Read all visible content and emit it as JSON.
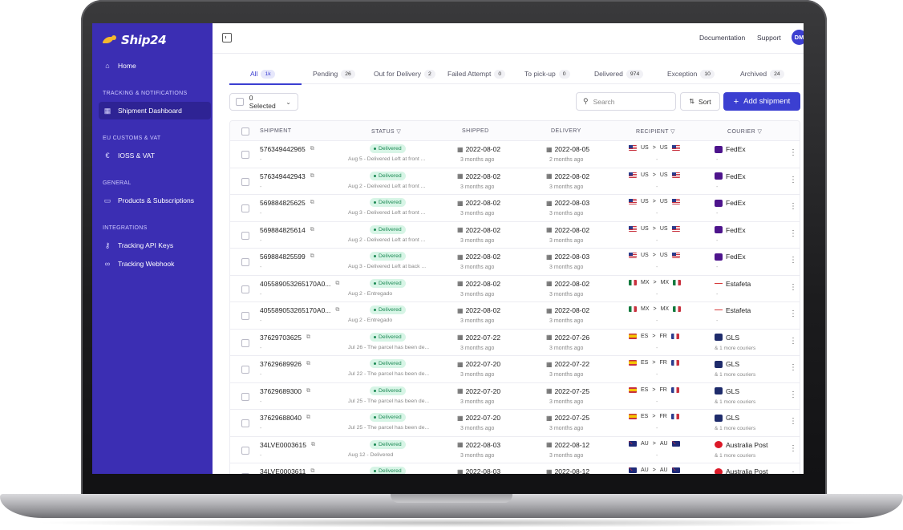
{
  "app": {
    "brand": "Ship24"
  },
  "sidebar": {
    "home": "Home",
    "sections": [
      {
        "title": "TRACKING & NOTIFICATIONS",
        "items": [
          "Shipment Dashboard"
        ]
      },
      {
        "title": "EU CUSTOMS & VAT",
        "items": [
          "IOSS & VAT"
        ]
      },
      {
        "title": "GENERAL",
        "items": [
          "Products & Subscriptions"
        ]
      },
      {
        "title": "INTEGRATIONS",
        "items": [
          "Tracking API Keys",
          "Tracking Webhook"
        ]
      }
    ]
  },
  "topbar": {
    "documentation": "Documentation",
    "support": "Support",
    "avatar": "DM"
  },
  "tabs": [
    {
      "label": "All",
      "count": "1k"
    },
    {
      "label": "Pending",
      "count": "26"
    },
    {
      "label": "Out for Delivery",
      "count": "2"
    },
    {
      "label": "Failed Attempt",
      "count": "0"
    },
    {
      "label": "To pick-up",
      "count": "0"
    },
    {
      "label": "Delivered",
      "count": "974"
    },
    {
      "label": "Exception",
      "count": "10"
    },
    {
      "label": "Archived",
      "count": "24"
    }
  ],
  "toolbar": {
    "selected": "0 Selected",
    "search_placeholder": "Search",
    "sort": "Sort",
    "add": "Add shipment"
  },
  "table": {
    "headers": [
      "SHIPMENT",
      "STATUS",
      "SHIPPED",
      "DELIVERY",
      "RECIPIENT",
      "COURIER"
    ],
    "rows": [
      {
        "id": "576349442965",
        "status": "Delivered",
        "note": "Aug 5 - Delivered Left at front ...",
        "shipped": "2022-08-02",
        "shipped_ago": "3 months ago",
        "delivery": "2022-08-05",
        "delivery_ago": "2 months ago",
        "from": "US",
        "to": "US",
        "from_flag": "us",
        "to_flag": "us",
        "courier": "FedEx",
        "courier_logo": "fedex",
        "more": ""
      },
      {
        "id": "576349442943",
        "status": "Delivered",
        "note": "Aug 2 - Delivered Left at front ...",
        "shipped": "2022-08-02",
        "shipped_ago": "3 months ago",
        "delivery": "2022-08-02",
        "delivery_ago": "3 months ago",
        "from": "US",
        "to": "US",
        "from_flag": "us",
        "to_flag": "us",
        "courier": "FedEx",
        "courier_logo": "fedex",
        "more": ""
      },
      {
        "id": "569884825625",
        "status": "Delivered",
        "note": "Aug 3 - Delivered Left at front ...",
        "shipped": "2022-08-02",
        "shipped_ago": "3 months ago",
        "delivery": "2022-08-03",
        "delivery_ago": "3 months ago",
        "from": "US",
        "to": "US",
        "from_flag": "us",
        "to_flag": "us",
        "courier": "FedEx",
        "courier_logo": "fedex",
        "more": ""
      },
      {
        "id": "569884825614",
        "status": "Delivered",
        "note": "Aug 2 - Delivered Left at front ...",
        "shipped": "2022-08-02",
        "shipped_ago": "3 months ago",
        "delivery": "2022-08-02",
        "delivery_ago": "3 months ago",
        "from": "US",
        "to": "US",
        "from_flag": "us",
        "to_flag": "us",
        "courier": "FedEx",
        "courier_logo": "fedex",
        "more": ""
      },
      {
        "id": "569884825599",
        "status": "Delivered",
        "note": "Aug 3 - Delivered Left at back ...",
        "shipped": "2022-08-02",
        "shipped_ago": "3 months ago",
        "delivery": "2022-08-03",
        "delivery_ago": "3 months ago",
        "from": "US",
        "to": "US",
        "from_flag": "us",
        "to_flag": "us",
        "courier": "FedEx",
        "courier_logo": "fedex",
        "more": ""
      },
      {
        "id": "405589053265170A0...",
        "status": "Delivered",
        "note": "Aug 2 - Entregado",
        "shipped": "2022-08-02",
        "shipped_ago": "3 months ago",
        "delivery": "2022-08-02",
        "delivery_ago": "3 months ago",
        "from": "MX",
        "to": "MX",
        "from_flag": "mx",
        "to_flag": "mx",
        "courier": "Estafeta",
        "courier_logo": "estafeta",
        "more": ""
      },
      {
        "id": "405589053265170A0...",
        "status": "Delivered",
        "note": "Aug 2 - Entregado",
        "shipped": "2022-08-02",
        "shipped_ago": "3 months ago",
        "delivery": "2022-08-02",
        "delivery_ago": "3 months ago",
        "from": "MX",
        "to": "MX",
        "from_flag": "mx",
        "to_flag": "mx",
        "courier": "Estafeta",
        "courier_logo": "estafeta",
        "more": ""
      },
      {
        "id": "37629703625",
        "status": "Delivered",
        "note": "Jul 26 - The parcel has been de...",
        "shipped": "2022-07-22",
        "shipped_ago": "3 months ago",
        "delivery": "2022-07-26",
        "delivery_ago": "3 months ago",
        "from": "ES",
        "to": "FR",
        "from_flag": "es",
        "to_flag": "fr",
        "courier": "GLS",
        "courier_logo": "gls",
        "more": "& 1 more couriers"
      },
      {
        "id": "37629689926",
        "status": "Delivered",
        "note": "Jul 22 - The parcel has been de...",
        "shipped": "2022-07-20",
        "shipped_ago": "3 months ago",
        "delivery": "2022-07-22",
        "delivery_ago": "3 months ago",
        "from": "ES",
        "to": "FR",
        "from_flag": "es",
        "to_flag": "fr",
        "courier": "GLS",
        "courier_logo": "gls",
        "more": "& 1 more couriers"
      },
      {
        "id": "37629689300",
        "status": "Delivered",
        "note": "Jul 25 - The parcel has been de...",
        "shipped": "2022-07-20",
        "shipped_ago": "3 months ago",
        "delivery": "2022-07-25",
        "delivery_ago": "3 months ago",
        "from": "ES",
        "to": "FR",
        "from_flag": "es",
        "to_flag": "fr",
        "courier": "GLS",
        "courier_logo": "gls",
        "more": "& 1 more couriers"
      },
      {
        "id": "37629688040",
        "status": "Delivered",
        "note": "Jul 25 - The parcel has been de...",
        "shipped": "2022-07-20",
        "shipped_ago": "3 months ago",
        "delivery": "2022-07-25",
        "delivery_ago": "3 months ago",
        "from": "ES",
        "to": "FR",
        "from_flag": "es",
        "to_flag": "fr",
        "courier": "GLS",
        "courier_logo": "gls",
        "more": "& 1 more couriers"
      },
      {
        "id": "34LVE0003615",
        "status": "Delivered",
        "note": "Aug 12 - Delivered",
        "shipped": "2022-08-03",
        "shipped_ago": "3 months ago",
        "delivery": "2022-08-12",
        "delivery_ago": "3 months ago",
        "from": "AU",
        "to": "AU",
        "from_flag": "au",
        "to_flag": "au",
        "courier": "Australia Post",
        "courier_logo": "auspost",
        "more": "& 1 more couriers"
      },
      {
        "id": "34LVE0003611",
        "status": "Delivered",
        "note": "",
        "shipped": "2022-08-03",
        "shipped_ago": "",
        "delivery": "2022-08-12",
        "delivery_ago": "",
        "from": "AU",
        "to": "AU",
        "from_flag": "au",
        "to_flag": "au",
        "courier": "Australia Post",
        "courier_logo": "auspost",
        "more": ""
      }
    ]
  }
}
